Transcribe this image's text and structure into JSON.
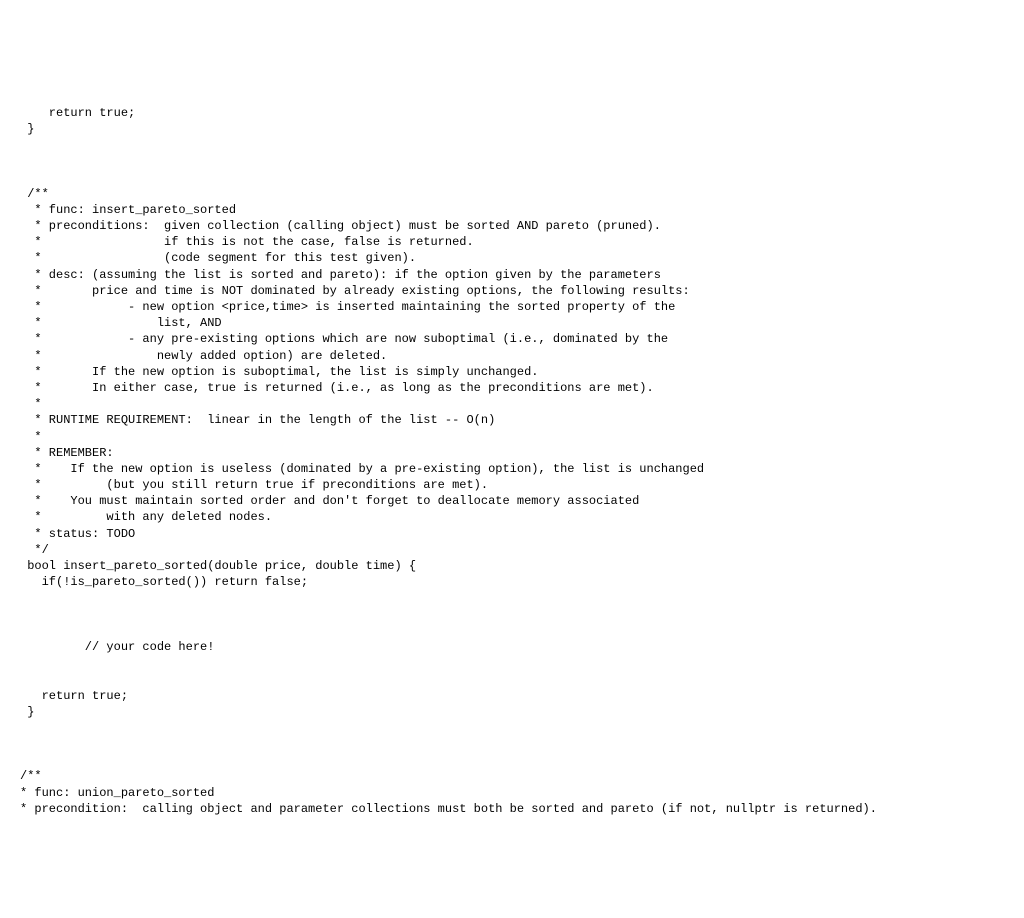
{
  "code": {
    "lines": [
      "    return true;",
      " }",
      "",
      "",
      "",
      " /**",
      "  * func: insert_pareto_sorted",
      "  * preconditions:  given collection (calling object) must be sorted AND pareto (pruned).",
      "  *                 if this is not the case, false is returned.",
      "  *                 (code segment for this test given).",
      "  * desc: (assuming the list is sorted and pareto): if the option given by the parameters",
      "  *       price and time is NOT dominated by already existing options, the following results:",
      "  *            - new option <price,time> is inserted maintaining the sorted property of the",
      "  *                list, AND",
      "  *            - any pre-existing options which are now suboptimal (i.e., dominated by the",
      "  *                newly added option) are deleted.",
      "  *       If the new option is suboptimal, the list is simply unchanged.",
      "  *       In either case, true is returned (i.e., as long as the preconditions are met).",
      "  *",
      "  * RUNTIME REQUIREMENT:  linear in the length of the list -- O(n)",
      "  *",
      "  * REMEMBER:  ",
      "  *    If the new option is useless (dominated by a pre-existing option), the list is unchanged",
      "  *         (but you still return true if preconditions are met).",
      "  *    You must maintain sorted order and don't forget to deallocate memory associated",
      "  *         with any deleted nodes.",
      "  * status: TODO",
      "  */",
      " bool insert_pareto_sorted(double price, double time) {",
      "   if(!is_pareto_sorted()) return false;",
      "",
      "",
      "",
      "         // your code here!",
      "",
      "",
      "   return true;",
      " }",
      "",
      "",
      "",
      "/**",
      "* func: union_pareto_sorted",
      "* precondition:  calling object and parameter collections must both be sorted and pareto (if not, nullptr is returned)."
    ]
  }
}
